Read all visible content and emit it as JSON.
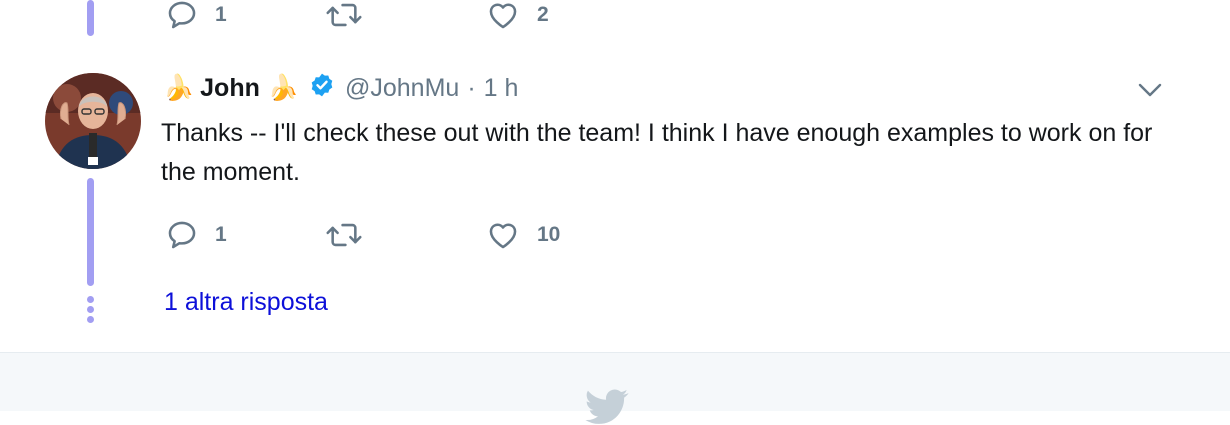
{
  "top_tweet": {
    "reply_count": "1",
    "retweet_count": "",
    "like_count": "2"
  },
  "tweet": {
    "name": "John",
    "name_emoji": "🍌",
    "handle": "@JohnMu",
    "separator": "·",
    "time": "1 h",
    "text": "Thanks -- I'll check these out with the team! I think I have enough examples to work on for the moment.",
    "reply_count": "1",
    "retweet_count": "",
    "like_count": "10"
  },
  "thread": {
    "more_replies_label": "1 altra risposta"
  },
  "colors": {
    "thread_line": "#a29ef2",
    "link": "#0d10d9",
    "verified": "#1da1f2",
    "muted": "#657786"
  },
  "icons": [
    "reply-icon",
    "retweet-icon",
    "like-icon",
    "verified-badge-icon",
    "caret-down-icon",
    "twitter-bird-icon"
  ]
}
